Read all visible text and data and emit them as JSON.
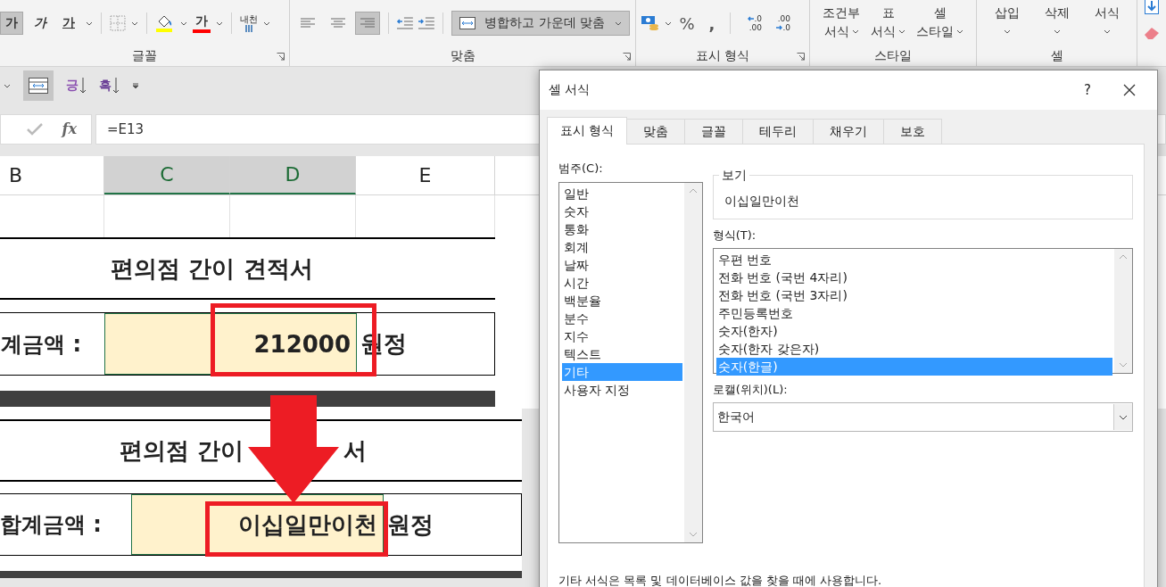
{
  "ribbon": {
    "font_group": {
      "label": "글꼴",
      "style_buttons": [
        {
          "kind": "bold",
          "glyph": "가",
          "pressed": true
        },
        {
          "kind": "italic",
          "glyph": "가",
          "pressed": false
        },
        {
          "kind": "underline",
          "glyph": "가",
          "pressed": false
        }
      ],
      "font_color_glyph": "가",
      "phonetic_glyph": "내천"
    },
    "align_group": {
      "label": "맞춤",
      "align_buttons": [
        {
          "kind": "left",
          "selected": false
        },
        {
          "kind": "center",
          "selected": false
        },
        {
          "kind": "right",
          "selected": true
        }
      ],
      "merge_button": "병합하고 가운데 맞춤"
    },
    "number_group": {
      "label": "표시 형식",
      "percent": "%",
      "comma": ",",
      "decimal_buttons": [
        {
          "kind": "increase",
          "top": ".0",
          "bottom": ".00"
        },
        {
          "kind": "decrease",
          "top": ".00",
          "bottom": ".0"
        }
      ]
    },
    "styles_group": {
      "label": "스타일",
      "buttons": [
        {
          "line1": "조건부",
          "line2": "서식"
        },
        {
          "line1": "표",
          "line2": "서식"
        },
        {
          "line1": "셀",
          "line2": "스타일"
        }
      ]
    },
    "cells_group": {
      "label": "셀",
      "buttons": [
        "삽입",
        "삭제",
        "서식"
      ]
    }
  },
  "quick_toolbar": {
    "merge_pressed": true,
    "sort_buttons": [
      {
        "kind": "ascending",
        "glyph": "긍"
      },
      {
        "kind": "descending",
        "glyph": "흑"
      }
    ]
  },
  "formula_bar": {
    "fx": "fx",
    "value": "=E13"
  },
  "sheet": {
    "columns": [
      {
        "label": "B",
        "selected": false
      },
      {
        "label": "C",
        "selected": true
      },
      {
        "label": "D",
        "selected": true
      },
      {
        "label": "E",
        "selected": false
      }
    ],
    "title": "편의점 간이 견적서",
    "total_label": "계금액 :",
    "total_value": "212000",
    "total_unit": "원정"
  },
  "pasted_sheet": {
    "title_left": "편의점 간이",
    "title_right": "서",
    "total_label": "합계금액 :",
    "total_value": "이십일만이천",
    "total_unit": "원정"
  },
  "dialog": {
    "title": "셀 서식",
    "help": "?",
    "tabs": [
      {
        "label": "표시 형식",
        "selected": true
      },
      {
        "label": "맞춤",
        "selected": false
      },
      {
        "label": "글꼴",
        "selected": false
      },
      {
        "label": "테두리",
        "selected": false
      },
      {
        "label": "채우기",
        "selected": false
      },
      {
        "label": "보호",
        "selected": false
      }
    ],
    "category_label": "범주(C):",
    "categories": [
      {
        "label": "일반",
        "selected": false
      },
      {
        "label": "숫자",
        "selected": false
      },
      {
        "label": "통화",
        "selected": false
      },
      {
        "label": "회계",
        "selected": false
      },
      {
        "label": "날짜",
        "selected": false
      },
      {
        "label": "시간",
        "selected": false
      },
      {
        "label": "백분율",
        "selected": false
      },
      {
        "label": "분수",
        "selected": false
      },
      {
        "label": "지수",
        "selected": false
      },
      {
        "label": "텍스트",
        "selected": false
      },
      {
        "label": "기타",
        "selected": true
      },
      {
        "label": "사용자 지정",
        "selected": false
      }
    ],
    "preview_label": "보기",
    "preview_value": "이십일만이천",
    "format_label": "형식(T):",
    "formats": [
      {
        "label": "우편 번호",
        "selected": false
      },
      {
        "label": "전화 번호 (국번 4자리)",
        "selected": false
      },
      {
        "label": "전화 번호 (국번 3자리)",
        "selected": false
      },
      {
        "label": "주민등록번호",
        "selected": false
      },
      {
        "label": "숫자(한자)",
        "selected": false
      },
      {
        "label": "숫자(한자 갖은자)",
        "selected": false
      },
      {
        "label": "숫자(한글)",
        "selected": true
      }
    ],
    "locale_label": "로캘(위치)(L):",
    "locale_value": "한국어",
    "description": "기타 서식은 목록 및 데이터베이스 값을 찾을 때에 사용합니다."
  }
}
